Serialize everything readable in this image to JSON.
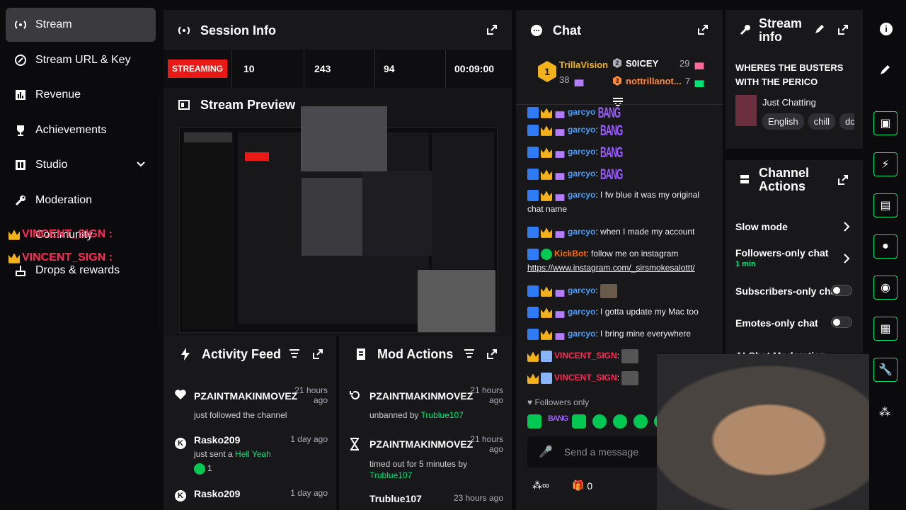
{
  "sidebar": {
    "items": [
      {
        "label": "Stream",
        "icon": "broadcast-icon"
      },
      {
        "label": "Stream URL & Key",
        "icon": "link-icon"
      },
      {
        "label": "Revenue",
        "icon": "chart-icon"
      },
      {
        "label": "Achievements",
        "icon": "trophy-icon"
      },
      {
        "label": "Studio",
        "icon": "studio-icon"
      },
      {
        "label": "Moderation",
        "icon": "wrench-icon"
      },
      {
        "label": "Community",
        "icon": "people-icon"
      },
      {
        "label": "Drops & rewards",
        "icon": "gift-icon"
      }
    ],
    "overlay_names": [
      "VINCENT_SIGN",
      "VINCENT_SIGN"
    ]
  },
  "session": {
    "title": "Session Info",
    "status": "STREAMING",
    "stats": [
      "10",
      "243",
      "94",
      "00:09:00"
    ]
  },
  "preview": {
    "title": "Stream Preview"
  },
  "activity": {
    "title": "Activity Feed",
    "items": [
      {
        "name": "PZAINTMAKINMOVEZ",
        "sub": "just followed the channel",
        "time": "21 hours ago",
        "icon": "heart-icon"
      },
      {
        "name": "Rasko209",
        "sub": "just sent a",
        "highlight": "Hell Yeah",
        "count": "1",
        "time": "1 day ago",
        "icon": "kick-icon"
      },
      {
        "name": "Rasko209",
        "sub": "",
        "time": "1 day ago",
        "icon": "kick-icon"
      }
    ]
  },
  "mod": {
    "title": "Mod Actions",
    "items": [
      {
        "name": "PZAINTMAKINMOVEZ",
        "sub": "unbanned by",
        "by": "Trublue107",
        "time": "21 hours ago",
        "icon": "undo-icon"
      },
      {
        "name": "PZAINTMAKINMOVEZ",
        "sub": "timed out for 5 minutes by",
        "by": "Trublue107",
        "time": "21 hours ago",
        "icon": "hourglass-icon"
      },
      {
        "name": "Trublue107",
        "sub": "",
        "time": "23 hours ago",
        "icon": ""
      }
    ]
  },
  "chat": {
    "title": "Chat",
    "leaders": [
      {
        "rank": "1",
        "name": "TrillaVision",
        "count": "38"
      },
      {
        "rank": "2",
        "name": "S0ICEY",
        "count": "29"
      },
      {
        "rank": "3",
        "name": "nottrillanot...",
        "count": "7"
      }
    ],
    "messages": [
      {
        "user": "garcyo",
        "text": ""
      },
      {
        "user": "garcyo",
        "text": ""
      },
      {
        "user": "garcyo",
        "text": ""
      },
      {
        "user": "garcyo",
        "text": "I fw blue it was my original chat name"
      },
      {
        "user": "garcyo",
        "text": "when I made my account"
      },
      {
        "user": "KickBot",
        "text": "follow me on instagram",
        "link": "https://www.instagram.com/_sirsmokesalottt/"
      },
      {
        "user": "garcyo",
        "text": ""
      },
      {
        "user": "garcyo",
        "text": "I gotta update my Mac too"
      },
      {
        "user": "garcyo",
        "text": "I bring mine everywhere"
      },
      {
        "user": "VINCENT_SIGN",
        "text": ""
      },
      {
        "user": "VINCENT_SIGN",
        "text": ""
      }
    ],
    "mode": "Followers only",
    "placeholder": "Send a message",
    "bottom_count": "0"
  },
  "stream_info": {
    "title": "Stream info",
    "stream_title": "WHERES THE BUSTERS WITH THE PERICO",
    "category": "Just Chatting",
    "tags": [
      "English",
      "chill",
      "dc"
    ]
  },
  "channel_actions": {
    "title": "Channel Actions",
    "items": [
      {
        "label": "Slow mode",
        "type": "chevron"
      },
      {
        "label": "Followers-only chat",
        "sub": "1 min",
        "type": "chevron"
      },
      {
        "label": "Subscribers-only chat",
        "type": "toggle"
      },
      {
        "label": "Emotes-only chat",
        "type": "toggle"
      },
      {
        "label": "AI Chat Moderation",
        "type": "link"
      }
    ]
  },
  "colors": {
    "accent": "#00e676",
    "live": "#e91916",
    "panel": "#18181b"
  }
}
